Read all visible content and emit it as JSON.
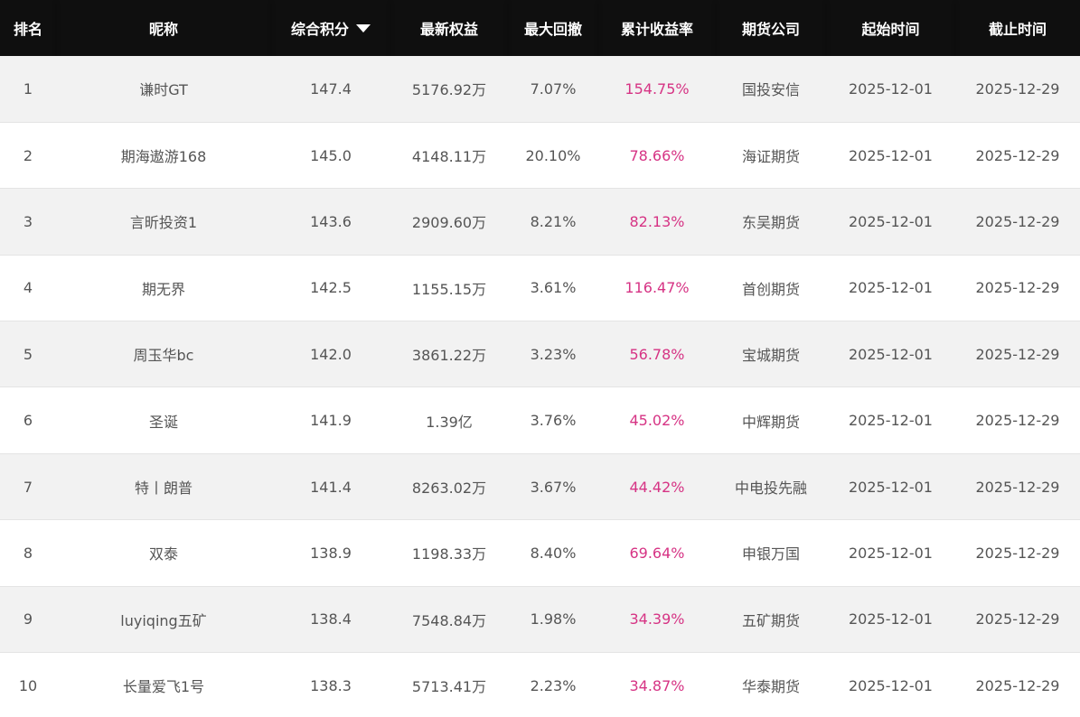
{
  "colors": {
    "header_bg": "#0f0f0f",
    "header_text": "#ffffff",
    "row_odd": "#f2f2f2",
    "row_even": "#ffffff",
    "cell_text": "#555555",
    "return_text": "#d63384"
  },
  "table": {
    "headers": [
      "排名",
      "昵称",
      "综合积分",
      "最新权益",
      "最大回撤",
      "累计收益率",
      "期货公司",
      "起始时间",
      "截止时间"
    ],
    "sort_icon": "caret-down-icon",
    "rows": [
      [
        "1",
        "谦时GT",
        "147.4",
        "5176.92万",
        "7.07%",
        "154.75%",
        "国投安信",
        "2025-12-01",
        "2025-12-29"
      ],
      [
        "2",
        "期海遨游168",
        "145.0",
        "4148.11万",
        "20.10%",
        "78.66%",
        "海证期货",
        "2025-12-01",
        "2025-12-29"
      ],
      [
        "3",
        "言昕投资1",
        "143.6",
        "2909.60万",
        "8.21%",
        "82.13%",
        "东吴期货",
        "2025-12-01",
        "2025-12-29"
      ],
      [
        "4",
        "期无界",
        "142.5",
        "1155.15万",
        "3.61%",
        "116.47%",
        "首创期货",
        "2025-12-01",
        "2025-12-29"
      ],
      [
        "5",
        "周玉华bc",
        "142.0",
        "3861.22万",
        "3.23%",
        "56.78%",
        "宝城期货",
        "2025-12-01",
        "2025-12-29"
      ],
      [
        "6",
        "圣诞",
        "141.9",
        "1.39亿",
        "3.76%",
        "45.02%",
        "中辉期货",
        "2025-12-01",
        "2025-12-29"
      ],
      [
        "7",
        "特丨朗普",
        "141.4",
        "8263.02万",
        "3.67%",
        "44.42%",
        "中电投先融",
        "2025-12-01",
        "2025-12-29"
      ],
      [
        "8",
        "双泰",
        "138.9",
        "1198.33万",
        "8.40%",
        "69.64%",
        "申银万国",
        "2025-12-01",
        "2025-12-29"
      ],
      [
        "9",
        "luyiqing五矿",
        "138.4",
        "7548.84万",
        "1.98%",
        "34.39%",
        "五矿期货",
        "2025-12-01",
        "2025-12-29"
      ],
      [
        "10",
        "长量爱飞1号",
        "138.3",
        "5713.41万",
        "2.23%",
        "34.87%",
        "华泰期货",
        "2025-12-01",
        "2025-12-29"
      ]
    ]
  }
}
